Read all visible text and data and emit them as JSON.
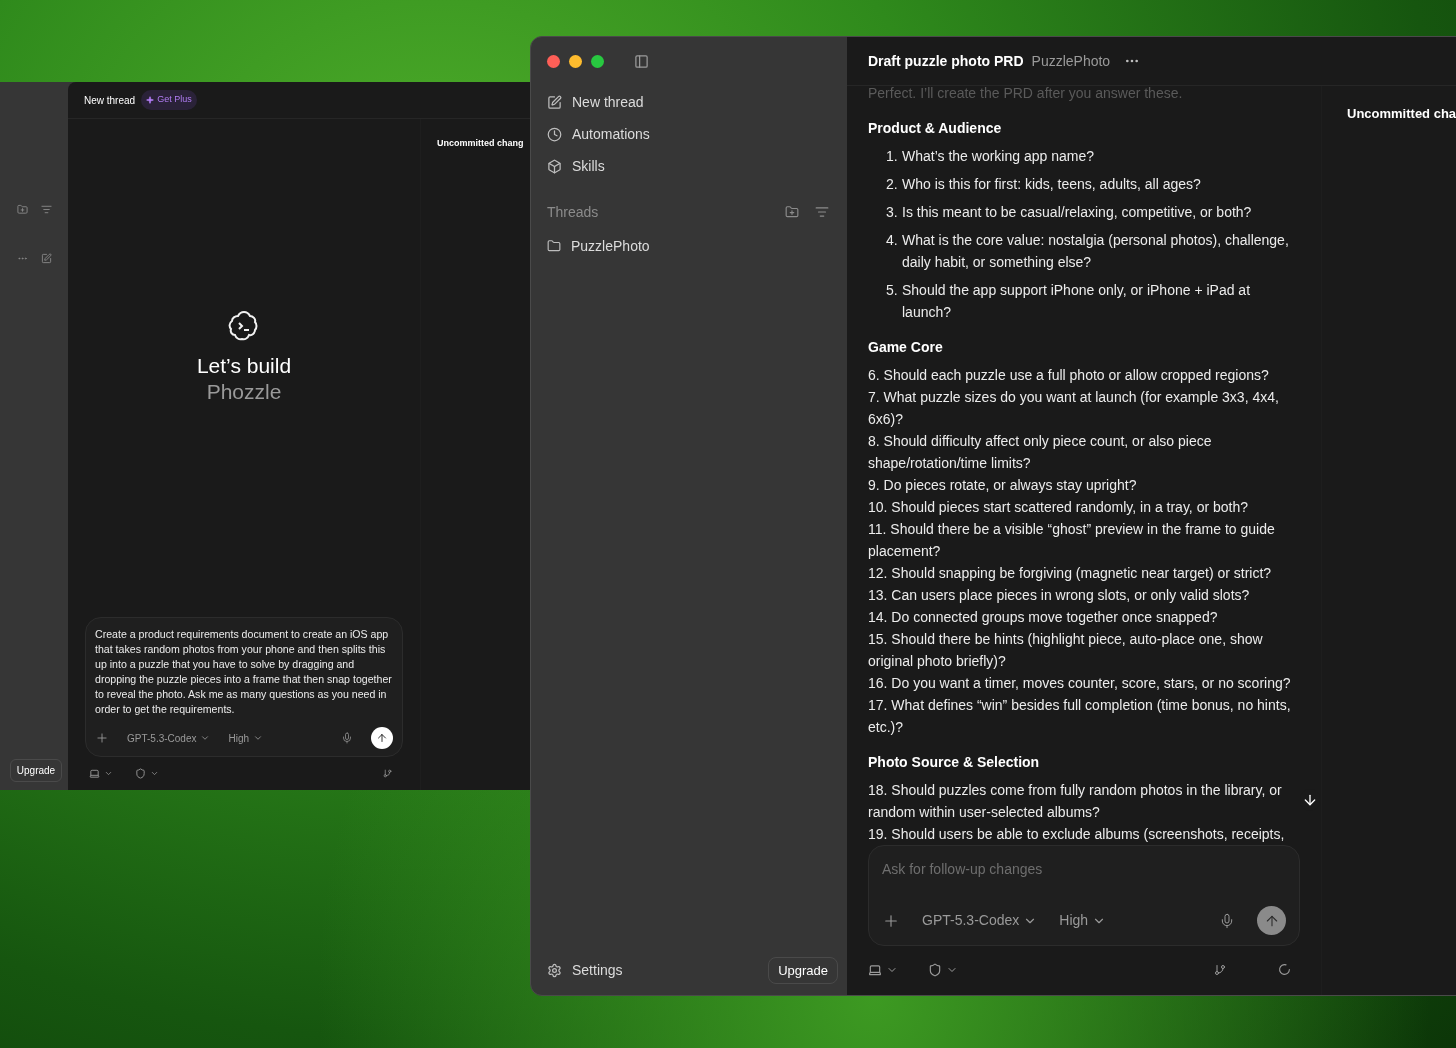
{
  "left_window": {
    "sidebar": {
      "upgrade": "Upgrade"
    },
    "header": {
      "title": "New thread",
      "badge": "Get Plus"
    },
    "side_panel": {
      "title": "Uncommitted chang"
    },
    "hero": {
      "line1": "Let’s build",
      "line2": "Phozzle"
    },
    "composer": {
      "value": "Create a product requirements document to create an iOS app that takes random photos from your phone and then splits this up into a puzzle that you have to solve by dragging and dropping the puzzle pieces into a frame that then snap together to reveal the photo. Ask me as many questions as you need in order to get the requirements.",
      "model": "GPT-5.3-Codex",
      "effort": "High"
    }
  },
  "right_window": {
    "sidebar": {
      "nav": [
        "New thread",
        "Automations",
        "Skills"
      ],
      "threads_label": "Threads",
      "threads": [
        "PuzzlePhoto"
      ],
      "settings": "Settings",
      "upgrade": "Upgrade"
    },
    "header": {
      "title": "Draft puzzle photo PRD",
      "project": "PuzzlePhoto"
    },
    "messages": {
      "intro": "Perfect. I’ll create the PRD after you answer these.",
      "sections": [
        {
          "kind": "ordered",
          "heading": "Product & Audience",
          "items": [
            {
              "number": "1.",
              "text": "What’s the working app name?"
            },
            {
              "number": "2.",
              "text": "Who is this for first: kids, teens, adults, all ages?"
            },
            {
              "number": "3.",
              "text": "Is this meant to be casual/relaxing, competitive, or both?"
            },
            {
              "number": "4.",
              "text": "What is the core value: nostalgia (personal photos), challenge, daily habit, or something else?"
            },
            {
              "number": "5.",
              "text": "Should the app support iPhone only, or iPhone + iPad at launch?"
            }
          ]
        },
        {
          "kind": "plain",
          "heading": "Game Core",
          "items": [
            "6. Should each puzzle use a full photo or allow cropped regions?",
            "7. What puzzle sizes do you want at launch (for example 3x3, 4x4, 6x6)?",
            "8. Should difficulty affect only piece count, or also piece shape/rotation/time limits?",
            "9. Do pieces rotate, or always stay upright?",
            "10. Should pieces start scattered randomly, in a tray, or both?",
            "11. Should there be a visible “ghost” preview in the frame to guide placement?",
            "12. Should snapping be forgiving (magnetic near target) or strict?",
            "13. Can users place pieces in wrong slots, or only valid slots?",
            "14. Do connected groups move together once snapped?",
            "15. Should there be hints (highlight piece, auto-place one, show original photo briefly)?",
            "16. Do you want a timer, moves counter, score, stars, or no scoring?",
            "17. What defines “win” besides full completion (time bonus, no hints, etc.)?"
          ]
        },
        {
          "kind": "plain",
          "heading": "Photo Source & Selection",
          "items": [
            "18. Should puzzles come from fully random photos in the library, or random within user-selected albums?",
            "19. Should users be able to exclude albums (screenshots, receipts,"
          ]
        }
      ]
    },
    "side_panel": {
      "title": "Uncommitted cha"
    },
    "composer": {
      "placeholder": "Ask for follow-up changes",
      "model": "GPT-5.3-Codex",
      "effort": "High"
    }
  }
}
